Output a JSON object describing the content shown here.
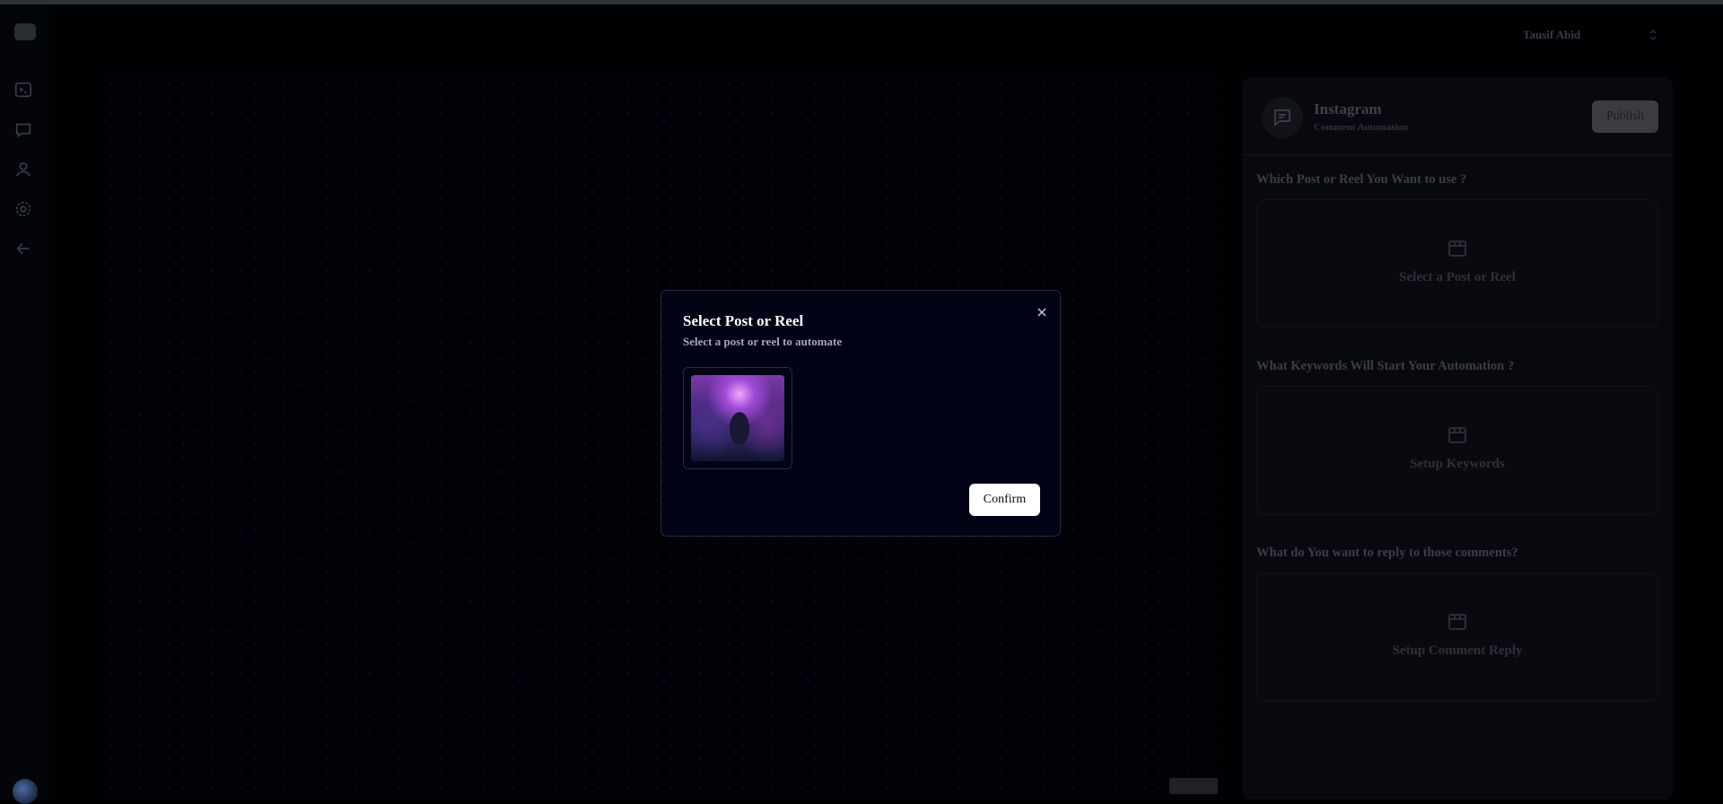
{
  "header": {
    "user_name": "Tausif Abid"
  },
  "sidebar": {
    "items": [
      {
        "icon": "terminal-icon"
      },
      {
        "icon": "chat-icon"
      },
      {
        "icon": "user-icon"
      },
      {
        "icon": "gear-icon"
      },
      {
        "icon": "arrow-left-icon"
      }
    ]
  },
  "panel": {
    "title": "Instagram",
    "subtitle": "Comment Automation",
    "publish_label": "Publish",
    "sections": [
      {
        "label": "Which Post or Reel You Want to use ?",
        "box_label": "Select a Post or Reel"
      },
      {
        "label": "What Keywords Will Start Your Automation ?",
        "box_label": "Setup Keywords"
      },
      {
        "label": "What do You want to reply to those comments?",
        "box_label": "Setup Comment Reply"
      }
    ]
  },
  "modal": {
    "title": "Select Post or Reel",
    "description": "Select a post or reel to automate",
    "confirm_label": "Confirm"
  },
  "colors": {
    "background": "#000103",
    "modal_bg": "#020314",
    "confirm_bg": "#ffffff"
  }
}
